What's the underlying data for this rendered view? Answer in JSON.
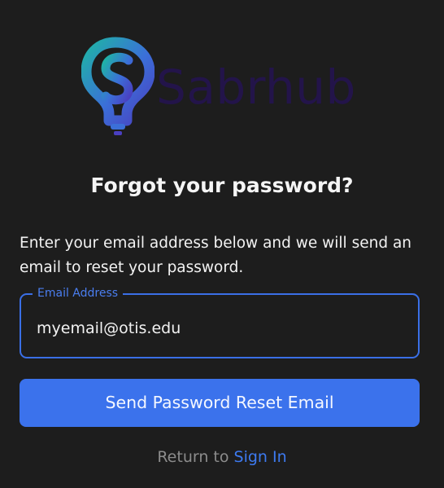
{
  "brand": {
    "name": "Sabrhub",
    "colors": {
      "text": "#23144a",
      "logo_gradient": [
        "#1fb3a6",
        "#3b6fd8",
        "#4a3fc0"
      ]
    }
  },
  "title": "Forgot your password?",
  "description": "Enter your email address below and we will send an email to reset your password.",
  "email_field": {
    "label": "Email Address",
    "value": "myemail@otis.edu"
  },
  "submit_button": {
    "label": "Send Password Reset Email"
  },
  "footer": {
    "prefix": "Return to",
    "link_label": "Sign In"
  },
  "theme": {
    "background": "#1d1d1d",
    "accent": "#3b72ec",
    "link": "#3d7af0"
  }
}
